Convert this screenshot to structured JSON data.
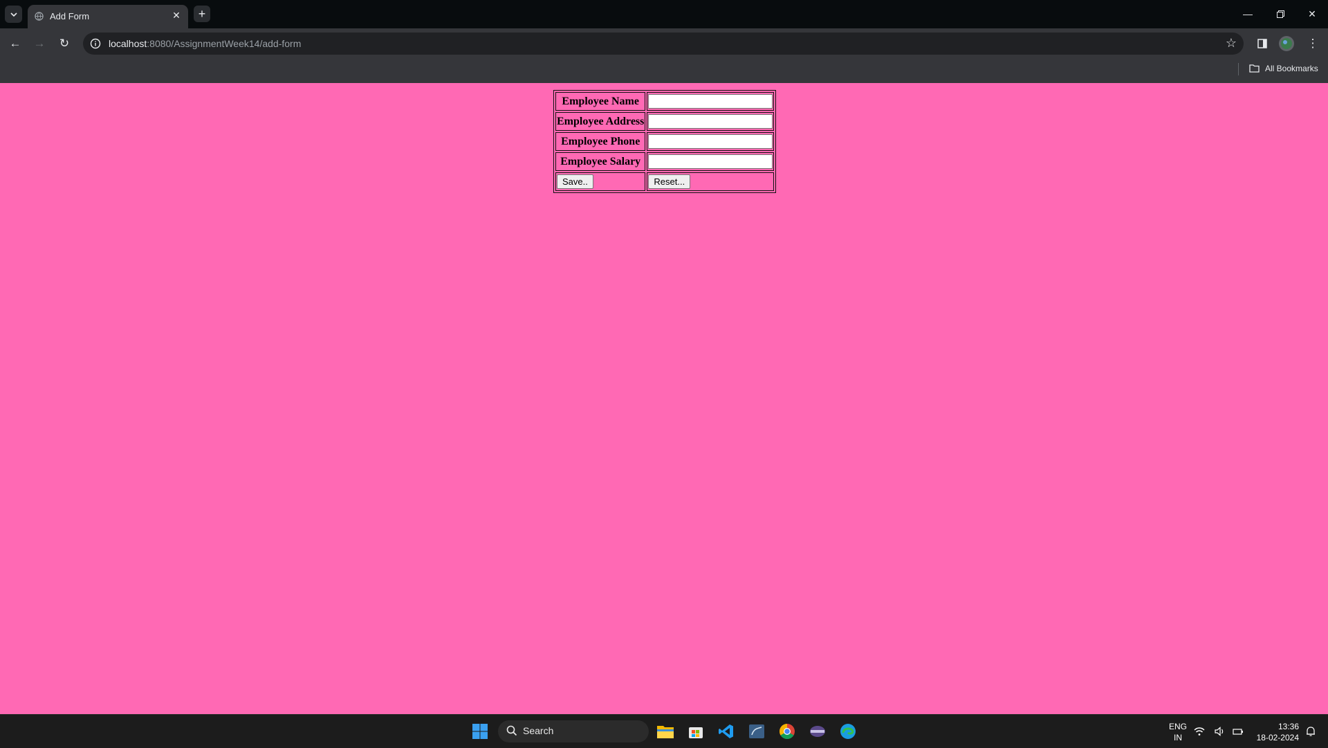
{
  "browser": {
    "tab_title": "Add Form",
    "url_host": "localhost",
    "url_path": ":8080/AssignmentWeek14/add-form",
    "bookmarks_label": "All Bookmarks"
  },
  "form": {
    "rows": [
      {
        "label": "Employee Name",
        "value": ""
      },
      {
        "label": "Employee Address",
        "value": ""
      },
      {
        "label": "Employee Phone",
        "value": ""
      },
      {
        "label": "Employee Salary",
        "value": ""
      }
    ],
    "save_label": "Save..",
    "reset_label": "Reset..."
  },
  "taskbar": {
    "search_label": "Search",
    "lang_line1": "ENG",
    "lang_line2": "IN",
    "time": "13:36",
    "date": "18-02-2024"
  },
  "colors": {
    "page_background": "#ff69b4",
    "chrome_dark": "#080c0e",
    "toolbar": "#35363a"
  },
  "icons": [
    "tab-list-icon",
    "globe-icon",
    "close-icon",
    "plus-icon",
    "minimize-icon",
    "restore-icon",
    "back-icon",
    "forward-icon",
    "reload-icon",
    "info-icon",
    "star-icon",
    "side-panel-icon",
    "profile-icon",
    "more-icon",
    "folder-icon",
    "windows-icon",
    "search-icon",
    "file-explorer-icon",
    "store-icon",
    "vscode-icon",
    "mysql-icon",
    "chrome-icon",
    "app-icon",
    "edge-icon",
    "wifi-icon",
    "volume-icon",
    "battery-icon",
    "bell-icon"
  ]
}
